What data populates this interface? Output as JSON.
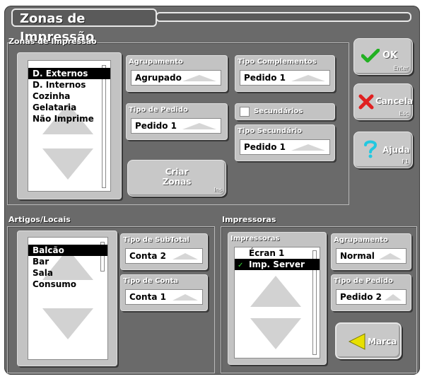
{
  "window": {
    "title": "Zonas de Impressão"
  },
  "zonas": {
    "label": "Zonas de Impressão",
    "list": [
      "D. Externos",
      "D. Internos",
      "Cozinha",
      "Gelataria",
      "Não Imprime"
    ],
    "selected_index": 0,
    "agrupamento": {
      "label": "Agrupamento",
      "value": "Agrupado"
    },
    "tipo_complementos": {
      "label": "Tipo Complementos",
      "value": "Pedido 1"
    },
    "tipo_pedido": {
      "label": "Tipo de Pedido",
      "value": "Pedido 1"
    },
    "secundarios": {
      "label": "Secundários",
      "checked": false
    },
    "tipo_secundario": {
      "label": "Tipo Secundário",
      "value": "Pedido 1"
    },
    "criar_zonas": {
      "line1": "Criar",
      "line2": "Zonas",
      "hotkey": "Ins"
    }
  },
  "buttons": {
    "ok": {
      "label": "OK",
      "hotkey": "Enter",
      "icon": "check-icon",
      "color": "#22b022"
    },
    "cancela": {
      "label": "Cancela",
      "hotkey": "Esc",
      "icon": "x-icon",
      "color": "#e02020"
    },
    "ajuda": {
      "label": "Ajuda",
      "hotkey": "F1",
      "icon": "question-icon",
      "color": "#22c8e0"
    },
    "marca": {
      "label": "Marca",
      "icon": "arrow-left-icon",
      "color": "#e8e000"
    }
  },
  "artigos": {
    "label": "Artigos/Locais",
    "list": [
      "Balcão",
      "Bar",
      "Sala",
      "Consumo"
    ],
    "selected_index": 0,
    "tipo_subtotal": {
      "label": "Tipo de SubTotal",
      "value": "Conta 2"
    },
    "tipo_conta": {
      "label": "Tipo de Conta",
      "value": "Conta 1"
    }
  },
  "impressoras": {
    "label": "Impressoras",
    "list_label": "Impressoras",
    "list": [
      "Écran 1",
      "Imp. Server"
    ],
    "selected_index": 1,
    "checked_mark": "✓",
    "agrupamento": {
      "label": "Agrupamento",
      "value": "Normal"
    },
    "tipo_pedido": {
      "label": "Tipo de Pedido",
      "value": "Pedido 2"
    }
  }
}
